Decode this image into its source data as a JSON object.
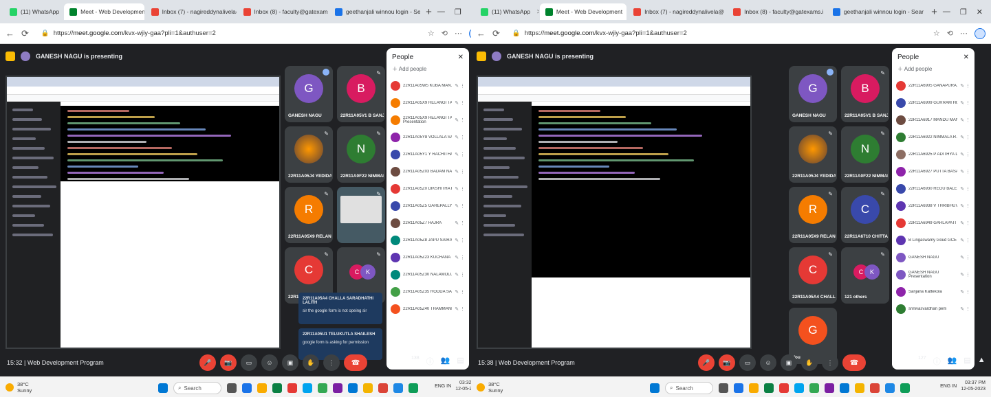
{
  "left": {
    "browser": {
      "tabs": [
        {
          "label": "(11) WhatsApp",
          "color": "#25d366"
        },
        {
          "label": "Meet - Web Development",
          "color": "#00832d",
          "active": true
        },
        {
          "label": "Inbox (7) - nagireddynalivela@",
          "color": "#ea4335"
        },
        {
          "label": "Inbox (8) - faculty@gatexams.i",
          "color": "#ea4335"
        },
        {
          "label": "geethanjali winnou login - Sear",
          "color": "#1a73e8"
        }
      ],
      "url_prefix": "https://",
      "url_host": "meet.google.com",
      "url_rest": "/kvx-wjiy-gaa?pli=1&authuser=2"
    },
    "presenting": "GANESH NAGU is presenting",
    "tiles": [
      {
        "name": "GANESH NAGU",
        "letter": "G",
        "color": "#7e57c2"
      },
      {
        "name": "22R11A05V1 B SANJANA",
        "letter": "B",
        "color": "#d81b60"
      },
      {
        "name": "22R11A05J4 YEDIDA VU...",
        "letter": "",
        "color": "#8d6e63"
      },
      {
        "name": "22R11A0F22 NIMMALA R...",
        "letter": "N",
        "color": "#2e7d32"
      },
      {
        "name": "22R11A05X9 RELANGI TA...",
        "letter": "R",
        "color": "#f57c00"
      },
      {
        "name": "",
        "letter": "",
        "color": "#555"
      },
      {
        "name": "22R11A05A4 CHALLA SA...",
        "letter": "C",
        "color": "#e53935"
      },
      {
        "name": "124 others",
        "letter": "",
        "color": "#3c4043"
      }
    ],
    "people": {
      "title": "People",
      "add": "Add people",
      "rows": [
        {
          "name": "22R11A05W5 KUBA MAN...",
          "color": "#e53935"
        },
        {
          "name": "22R11A05X9 RELANGI TA...",
          "color": "#f57c00"
        },
        {
          "name": "22R11A05X9 RELANGI TA...",
          "sub": "Presentation",
          "color": "#f57c00"
        },
        {
          "name": "22R11A05Y8 VOLLALA SA...",
          "color": "#8e24aa"
        },
        {
          "name": "22R11A05Y1 Y RACHITHA",
          "color": "#3949ab"
        },
        {
          "name": "22R11A05Z03 BADAM NAV...",
          "color": "#6d4c41"
        },
        {
          "name": "22R11A05Z0 DIKSHITHA R...",
          "color": "#e53935"
        },
        {
          "name": "22R11A05Z5 GAREPALLY...",
          "color": "#3949ab"
        },
        {
          "name": "22R11A05Z7 HAJRA",
          "color": "#6d4c41"
        },
        {
          "name": "22R11A05Z8 JAPU SAIRAJ",
          "color": "#00897b"
        },
        {
          "name": "22R11A05Z23 KUCHANA SA...",
          "color": "#5e35b1"
        },
        {
          "name": "22R11A05Z30 NALAMOLU...",
          "color": "#00897b"
        },
        {
          "name": "22R11A05Z35 RODDA SAN...",
          "color": "#43a047"
        },
        {
          "name": "22R11A05Z40 THAMMANN...",
          "color": "#f4511e"
        }
      ]
    },
    "chat": [
      {
        "name": "22R11A05A4 CHALLA SARADHATHI LALITH",
        "msg": "sir the google form is not opeing sir"
      },
      {
        "name": "22R11A05U1 TELUKUTLA SHAILESH",
        "msg": "google form is asking for permission"
      }
    ],
    "meeting": "15:32 | Web Development Program",
    "badge": "138",
    "taskbar": {
      "temp": "38°C",
      "weather": "Sunny",
      "search": "Search",
      "lang": "ENG IN",
      "time": "03:32 PM",
      "date": "12-05-2023"
    }
  },
  "right": {
    "browser": {
      "tabs": [
        {
          "label": "(11) WhatsApp",
          "color": "#25d366"
        },
        {
          "label": "Meet - Web Development",
          "color": "#00832d",
          "active": true
        },
        {
          "label": "Inbox (7) - nagireddynalivela@",
          "color": "#ea4335"
        },
        {
          "label": "Inbox (8) - faculty@gatexams.i",
          "color": "#ea4335"
        },
        {
          "label": "geethanjali winnou login - Sear",
          "color": "#1a73e8"
        }
      ],
      "url_prefix": "https://",
      "url_host": "meet.google.com",
      "url_rest": "/kvx-wjiy-gaa?pli=1&authuser=2"
    },
    "presenting": "GANESH NAGU is presenting",
    "tiles": [
      {
        "name": "GANESH NAGU",
        "letter": "G",
        "color": "#7e57c2"
      },
      {
        "name": "22R11A05V1 B SANJANA",
        "letter": "B",
        "color": "#d81b60"
      },
      {
        "name": "22R11A05J4 YEDIDA VU...",
        "letter": "",
        "color": "#8d6e63"
      },
      {
        "name": "22R11A0F22 NIMMALA R...",
        "letter": "N",
        "color": "#2e7d32"
      },
      {
        "name": "22R11A05X9 RELANGI TA...",
        "letter": "R",
        "color": "#f57c00"
      },
      {
        "name": "22R11A6710 CHITTA HAR...",
        "letter": "C",
        "color": "#3949ab"
      },
      {
        "name": "22R11A05A4 CHALLA SA...",
        "letter": "C",
        "color": "#e53935"
      },
      {
        "name": "121 others",
        "letter": "",
        "color": "#3c4043"
      }
    ],
    "you": {
      "name": "You",
      "letter": "G"
    },
    "people": {
      "title": "People",
      "add": "Add people",
      "rows": [
        {
          "name": "22R11A6905 GANAPURA...",
          "color": "#e53935"
        },
        {
          "name": "22R11A6909 GURRAM HO...",
          "color": "#3949ab"
        },
        {
          "name": "22R11A6917 MANDU MAN...",
          "color": "#6d4c41"
        },
        {
          "name": "22R11A6922 NIMMALA R...",
          "color": "#2e7d32"
        },
        {
          "name": "22R11A6925 P ADITHYA D...",
          "color": "#8d6e63"
        },
        {
          "name": "22R11A6927 PUTTA BASA...",
          "color": "#8e24aa"
        },
        {
          "name": "22R11A6930 REGU BALES...",
          "color": "#3949ab"
        },
        {
          "name": "22R11A6938 V THRIBHUVAN",
          "color": "#5e35b1"
        },
        {
          "name": "22R11A6949 GARLAPATI T...",
          "color": "#e53935"
        },
        {
          "name": "B Lingaswamy Goud GCET",
          "color": "#5e35b1"
        },
        {
          "name": "GANESH NAGU",
          "color": "#7e57c2"
        },
        {
          "name": "GANESH NAGU",
          "sub": "Presentation",
          "color": "#7e57c2"
        },
        {
          "name": "Sanjana Kattekola",
          "color": "#8e24aa"
        },
        {
          "name": "srinivasvardhan perli",
          "color": "#2e7d32"
        }
      ]
    },
    "meeting": "15:38 | Web Development Program",
    "badge": "127",
    "taskbar": {
      "temp": "38°C",
      "weather": "Sunny",
      "search": "Search",
      "lang": "ENG IN",
      "time": "03:37 PM",
      "date": "12-05-2023"
    }
  }
}
